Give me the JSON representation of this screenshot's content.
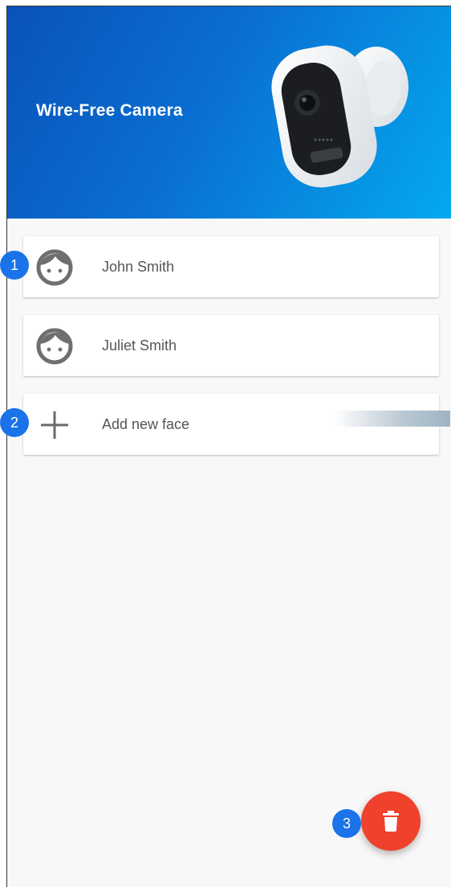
{
  "header": {
    "title": "Wire-Free Camera",
    "image": "camera-icon",
    "gradient_start": "#0a52b8",
    "gradient_end": "#04a9ee"
  },
  "faces": [
    {
      "label": "John Smith",
      "icon": "face-icon"
    },
    {
      "label": "Juliet Smith",
      "icon": "face-icon"
    }
  ],
  "add_face": {
    "label": "Add new face",
    "icon": "plus-icon"
  },
  "fab": {
    "icon": "trash-icon",
    "color": "#f0412c"
  },
  "badges": [
    "1",
    "2",
    "3"
  ],
  "colors": {
    "badge": "#1a73e8",
    "background": "#f8f8f8",
    "text": "#555555"
  }
}
